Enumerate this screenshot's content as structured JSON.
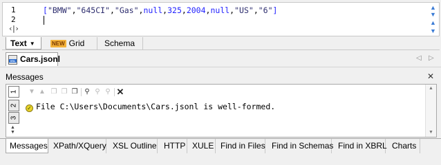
{
  "editor": {
    "line_numbers": [
      "1",
      "2"
    ],
    "code_tokens": [
      {
        "t": "[",
        "c": "br"
      },
      {
        "t": "\"BMW\"",
        "c": "str"
      },
      {
        "t": ",",
        "c": "p"
      },
      {
        "t": "\"645CI\"",
        "c": "str"
      },
      {
        "t": ",",
        "c": "p"
      },
      {
        "t": "\"Gas\"",
        "c": "str"
      },
      {
        "t": ",",
        "c": "p"
      },
      {
        "t": "null",
        "c": "kw"
      },
      {
        "t": ",",
        "c": "p"
      },
      {
        "t": "325",
        "c": "num"
      },
      {
        "t": ",",
        "c": "p"
      },
      {
        "t": "2004",
        "c": "num"
      },
      {
        "t": ",",
        "c": "p"
      },
      {
        "t": "null",
        "c": "kw"
      },
      {
        "t": ",",
        "c": "p"
      },
      {
        "t": "\"US\"",
        "c": "str"
      },
      {
        "t": ",",
        "c": "p"
      },
      {
        "t": "\"6\"",
        "c": "str"
      },
      {
        "t": "]",
        "c": "br"
      }
    ],
    "fold_icon": "fold-collapse-icon"
  },
  "view_tabs": {
    "text_label": "Text",
    "text_dropdown": "▼",
    "new_badge": "NEW",
    "grid_label": "Grid",
    "schema_label": "Schema"
  },
  "document": {
    "file_tab": "Cars.jsonl",
    "file_icon_text": "XSL"
  },
  "messages": {
    "title": "Messages",
    "side_tabs": [
      "1",
      "2",
      "3"
    ],
    "message_text": "File C:\\Users\\Documents\\Cars.jsonl is well-formed."
  },
  "bottom_tabs": [
    "Messages",
    "XPath/XQuery",
    "XSL Outline",
    "HTTP",
    "XULE",
    "Find in Files",
    "Find in Schemas",
    "Find in XBRL",
    "Charts"
  ],
  "colors": {
    "code_blue": "#1f1fff",
    "string_dark": "#2d2d6e",
    "new_badge": "#f3b23a",
    "ok_icon": "#e9d32c"
  }
}
